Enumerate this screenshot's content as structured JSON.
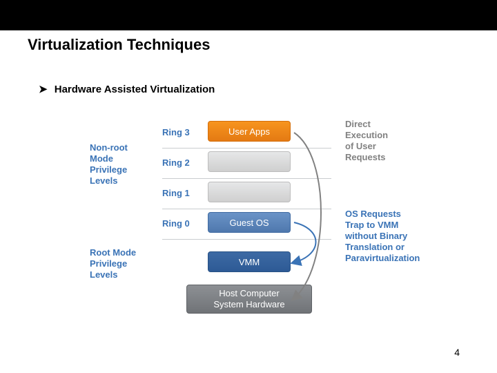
{
  "title": "Virtualization Techniques",
  "bullet": {
    "marker": "➤",
    "text": "Hardware Assisted Virtualization"
  },
  "left_labels": {
    "nonroot": "Non-root\nMode\nPrivilege\nLevels",
    "root": "Root Mode\nPrivilege\nLevels"
  },
  "rings": {
    "r3": "Ring 3",
    "r2": "Ring 2",
    "r1": "Ring 1",
    "r0": "Ring 0"
  },
  "boxes": {
    "user_apps": "User Apps",
    "guest_os": "Guest OS",
    "vmm": "VMM",
    "hw_line1": "Host Computer",
    "hw_line2": "System Hardware"
  },
  "right_labels": {
    "direct": "Direct\nExecution\nof User\nRequests",
    "trap": "OS Requests\nTrap to VMM\nwithout Binary\nTranslation or\nParavirtualization"
  },
  "page_number": "4"
}
